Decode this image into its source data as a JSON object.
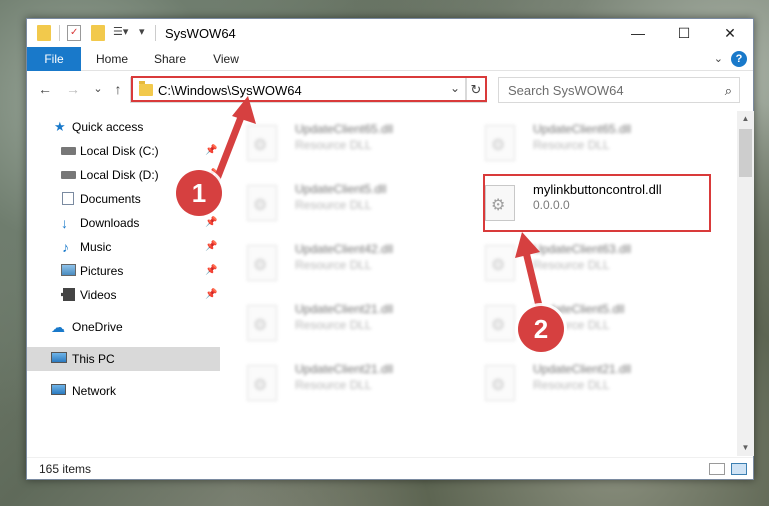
{
  "window": {
    "title": "SysWOW64"
  },
  "ribbon": {
    "tabs": [
      "File",
      "Home",
      "Share",
      "View"
    ],
    "help": "?"
  },
  "nav": {
    "back": "←",
    "forward": "→",
    "recent": "⌄",
    "up": "↑",
    "address": "C:\\Windows\\SysWOW64",
    "address_chevron": "⌄",
    "refresh": "↻",
    "search_placeholder": "Search SysWOW64",
    "search_glyph": "⌕"
  },
  "window_controls": {
    "minimize": "—",
    "maximize": "☐",
    "close": "✕"
  },
  "sidebar": {
    "items": [
      {
        "label": "Quick access",
        "icon": "star-icon",
        "pinned": false
      },
      {
        "label": "Local Disk (C:)",
        "icon": "drive-icon",
        "pinned": true
      },
      {
        "label": "Local Disk (D:)",
        "icon": "drive-icon",
        "pinned": true
      },
      {
        "label": "Documents",
        "icon": "documents-icon",
        "pinned": true
      },
      {
        "label": "Downloads",
        "icon": "download-icon",
        "pinned": true
      },
      {
        "label": "Music",
        "icon": "music-icon",
        "pinned": true
      },
      {
        "label": "Pictures",
        "icon": "pictures-icon",
        "pinned": true
      },
      {
        "label": "Videos",
        "icon": "videos-icon",
        "pinned": true
      },
      {
        "label": "OneDrive",
        "icon": "cloud-icon",
        "pinned": false
      },
      {
        "label": "This PC",
        "icon": "computer-icon",
        "pinned": false,
        "selected": true
      },
      {
        "label": "Network",
        "icon": "network-icon",
        "pinned": false
      }
    ],
    "pin_glyph": "📌"
  },
  "files": {
    "left": [
      {
        "name": "UpdateClient65.dll",
        "type": "Resource DLL"
      },
      {
        "name": "UpdateClient5.dll",
        "type": "Resource DLL"
      },
      {
        "name": "UpdateClient42.dll",
        "type": "Resource DLL"
      },
      {
        "name": "UpdateClient21.dll",
        "type": "Resource DLL"
      },
      {
        "name": "UpdateClient21.dll",
        "type": "Resource DLL"
      }
    ],
    "right": [
      {
        "name": "UpdateClient65.dll",
        "type": "Resource DLL"
      },
      {
        "name": "mylinkbuttoncontrol.dll",
        "type": "0.0.0.0",
        "focused": true
      },
      {
        "name": "UpdateClient63.dll",
        "type": "Resource DLL"
      },
      {
        "name": "UpdateClient5.dll",
        "type": "Resource DLL"
      },
      {
        "name": "UpdateClient21.dll",
        "type": "Resource DLL"
      }
    ]
  },
  "status": {
    "count": "165 items"
  },
  "scroll": {
    "up": "▲",
    "down": "▼"
  },
  "annotations": {
    "step1": "1",
    "step2": "2",
    "color": "#d64040"
  },
  "colors": {
    "accent": "#1979ca",
    "highlight": "#d93a3a",
    "selected": "#d9d9d9"
  }
}
